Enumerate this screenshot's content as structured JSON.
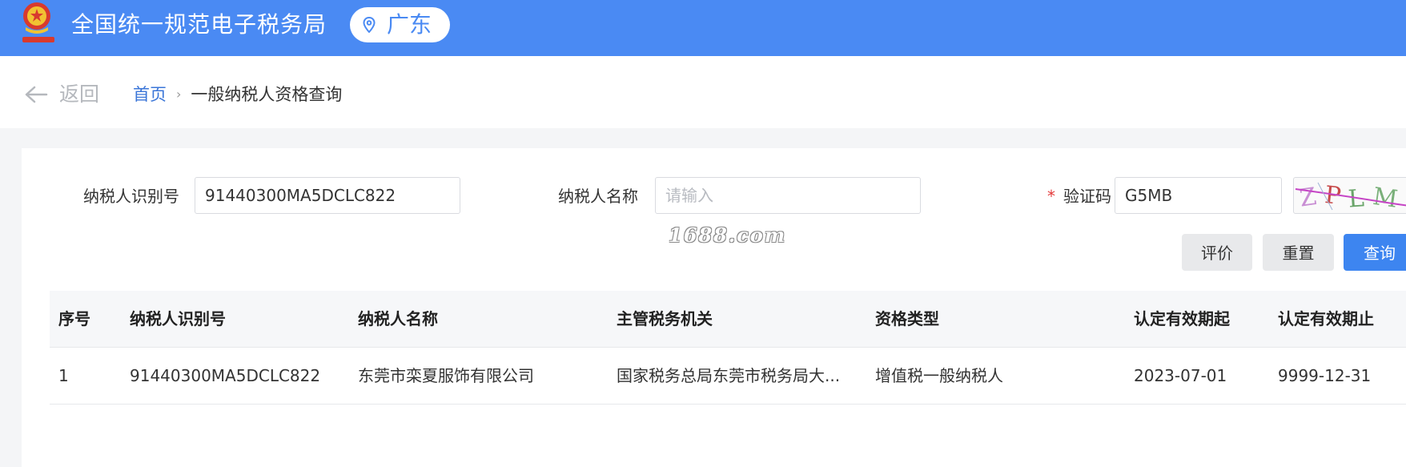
{
  "header": {
    "title": "全国统一规范电子税务局",
    "region": "广东",
    "brand_color": "#4a8af3"
  },
  "nav": {
    "back_label": "返回",
    "breadcrumb": {
      "home": "首页",
      "current": "一般纳税人资格查询"
    }
  },
  "form": {
    "taxpayer_id_label": "纳税人识别号",
    "taxpayer_id_value": "91440300MA5DCLC822",
    "taxpayer_name_label": "纳税人名称",
    "taxpayer_name_value": "",
    "taxpayer_name_placeholder": "请输入",
    "captcha_required_mark": "*",
    "captcha_label": "验证码",
    "captcha_value": "G5MB",
    "captcha_image_text": "ZPLM"
  },
  "watermark": "1688.com",
  "buttons": {
    "evaluate": "评价",
    "reset": "重置",
    "search": "查询"
  },
  "table": {
    "columns": [
      "序号",
      "纳税人识别号",
      "纳税人名称",
      "主管税务机关",
      "资格类型",
      "认定有效期起",
      "认定有效期止"
    ],
    "rows": [
      [
        "1",
        "91440300MA5DCLC822",
        "东莞市栾夏服饰有限公司",
        "国家税务总局东莞市税务局大...",
        "增值税一般纳税人",
        "2023-07-01",
        "9999-12-31"
      ]
    ]
  }
}
